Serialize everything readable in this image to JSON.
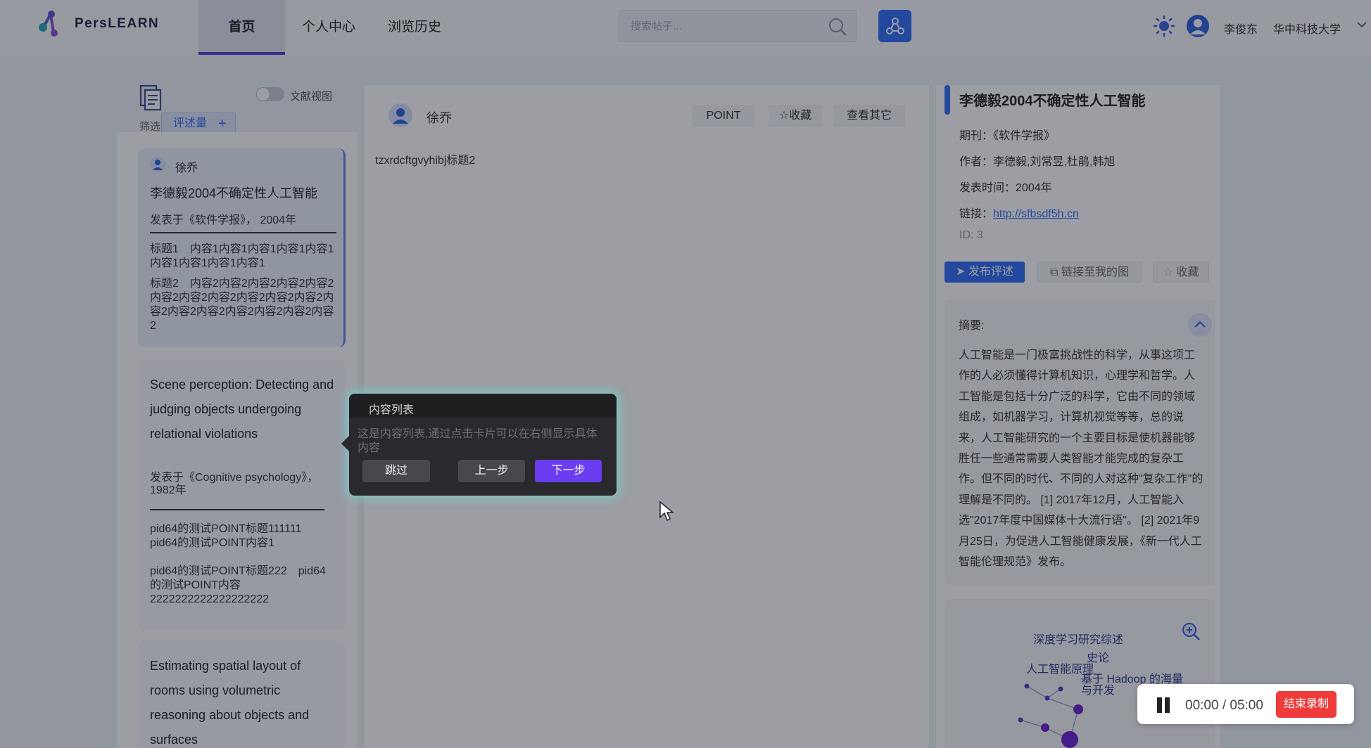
{
  "header": {
    "logo_text": "PersLEARN",
    "nav": [
      "首页",
      "个人中心",
      "浏览历史"
    ],
    "search_placeholder": "搜索帖子...",
    "user_name": "李俊东",
    "org_name": "华中科技大学"
  },
  "sidebar": {
    "filter_label": "筛选",
    "sort_tag": "评述量",
    "toggle_label": "文献视图",
    "cards": [
      {
        "author": "徐乔",
        "title": "李德毅2004不确定性人工智能",
        "venue": "发表于《软件学报》， 2004年",
        "points": [
          "标题1　内容1内容1内容1内容1内容1内容1内容1内容1内容1",
          "标题2　内容2内容2内容2内容2内容2内容2内容2内容2内容2内容2内容2内容2内容2内容2内容2内容2内容2内容2"
        ]
      },
      {
        "title": "Scene perception: Detecting and judging objects undergoing relational violations",
        "venue": "发表于《Cognitive psychology》， 1982年",
        "points": [
          "pid64的测试POINT标题111111　pid64的测试POINT内容1",
          "pid64的测试POINT标题222　pid64的测试POINT内容2222222222222222222"
        ]
      },
      {
        "title": "Estimating spatial layout of rooms using volumetric reasoning about objects and surfaces"
      }
    ]
  },
  "middle": {
    "author": "徐乔",
    "buttons": [
      "POINT",
      "☆收藏",
      "查看其它"
    ],
    "text": "tzxrdcftgvyhibj标题2"
  },
  "detail": {
    "title": "李德毅2004不确定性人工智能",
    "journal_label": "期刊：",
    "journal": "《软件学报》",
    "authors_label": "作者：",
    "authors": "李德毅,刘常昱,杜鹃,韩旭",
    "time_label": "发表时间：",
    "time": "2004年",
    "link_label": "链接：",
    "link": "http://sfbsdf5h.cn",
    "id": "ID: 3",
    "buttons": [
      "发布评述",
      "链接至我的图",
      "收藏"
    ],
    "abstract_label": "摘要:",
    "abstract": "人工智能是一门极富挑战性的科学，从事这项工作的人必须懂得计算机知识，心理学和哲学。人工智能是包括十分广泛的科学，它由不同的领域组成，如机器学习，计算机视觉等等，总的说来，人工智能研究的一个主要目标是使机器能够胜任一些通常需要人类智能才能完成的复杂工作。但不同的时代、不同的人对这种\"复杂工作\"的理解是不同的。 [1] 2017年12月，人工智能入选\"2017年度中国媒体十大流行语\"。 [2] 2021年9月25日，为促进人工智能健康发展，《新一代人工智能伦理规范》发布。",
    "graph_labels": [
      "深度学习研究综述",
      "史论",
      "人工智能原理",
      "基于 Hadoop 的海量",
      "与开发"
    ]
  },
  "tour": {
    "title": "内容列表",
    "description": "这是内容列表,通过点击卡片可以在右侧显示具体内容",
    "skip": "跳过",
    "prev": "上一步",
    "next": "下一步"
  },
  "recording": {
    "time": "00:00 / 05:00",
    "stop": "结束录制"
  },
  "colors": {
    "primary": "#2f6bf5",
    "tour_next": "#6a3df0",
    "record_stop": "#ef3b3b"
  }
}
